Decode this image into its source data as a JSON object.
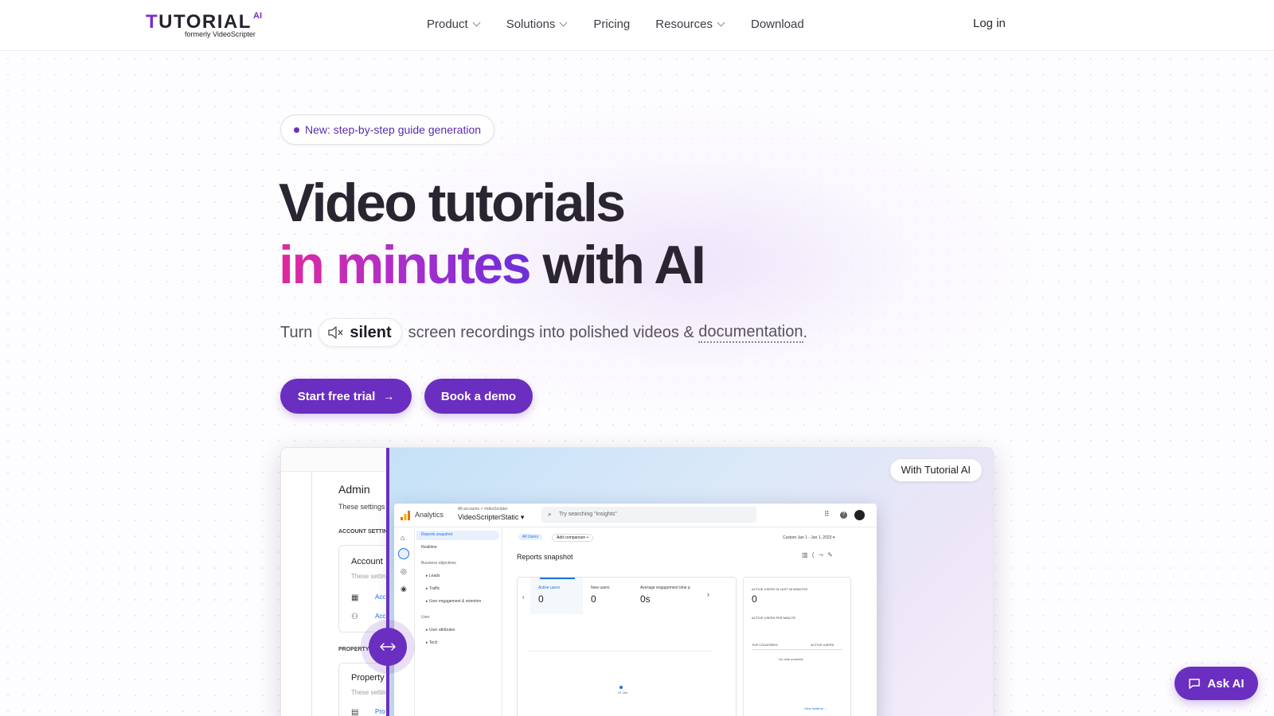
{
  "brand": {
    "logo_text": "UTORIAL",
    "logo_first_letter": "T",
    "logo_ai": "AI",
    "logo_sub": "formerly VideoScripter",
    "accent_color": "#6a2fc0"
  },
  "nav": {
    "items": [
      {
        "label": "Product",
        "has_dropdown": true
      },
      {
        "label": "Solutions",
        "has_dropdown": true
      },
      {
        "label": "Pricing",
        "has_dropdown": false
      },
      {
        "label": "Resources",
        "has_dropdown": true
      },
      {
        "label": "Download",
        "has_dropdown": false
      }
    ],
    "login": "Log in"
  },
  "hero": {
    "badge": "New: step-by-step guide generation",
    "headline_line1": "Video tutorials",
    "headline_grad": "in minutes",
    "headline_rest": "with AI",
    "sub_before": "Turn",
    "sub_chip": "silent",
    "sub_middle": "screen recordings into polished videos &",
    "sub_link": "documentation",
    "sub_end": ".",
    "cta_primary": "Start free trial",
    "cta_primary_icon": "arrow-right-icon",
    "cta_secondary": "Book a demo"
  },
  "preview": {
    "with_badge": "With Tutorial AI",
    "before": {
      "title": "Admin",
      "subtitle": "These settings a",
      "section1": "ACCOUNT SETTING",
      "card1_title": "Account",
      "card1_sub": "These setting",
      "card1_row1": "Acc",
      "card1_row2": "Acc",
      "section2": "PROPERTY S",
      "card2_title": "Property",
      "card2_sub": "These setting",
      "card2_row1": "Pro"
    },
    "ga": {
      "app": "Analytics",
      "breadcrumb": "All accounts > VideoScripter",
      "property": "VideoScripterStatic",
      "search_placeholder": "Try searching \"insights\"",
      "nav_items": [
        "Reports snapshot",
        "Realtime",
        "Business objectives",
        "Leads",
        "Traffic",
        "User engagement & retention",
        "User",
        "User attributes",
        "Tech"
      ],
      "filter_all": "All Users",
      "filter_add": "Add comparison +",
      "date_range": "Custom   Jan 1 - Jan 1, 2023",
      "report_title": "Reports snapshot",
      "metric1_label": "Active users",
      "metric1_value": "0",
      "metric2_label": "New users",
      "metric2_value": "0",
      "metric3_label": "Average engagement time p",
      "metric3_value": "0s",
      "realtime_label": "ACTIVE USERS IN LAST 30 MINUTES",
      "realtime_value": "0",
      "per_minute": "ACTIVE USERS PER MINUTE",
      "top_countries": "TOP COUNTRIES",
      "active_users_col": "ACTIVE USERS",
      "no_data": "No data available",
      "view_realtime": "View realtime →",
      "axis_label": "01\nJan"
    }
  },
  "ask_ai": "Ask AI"
}
